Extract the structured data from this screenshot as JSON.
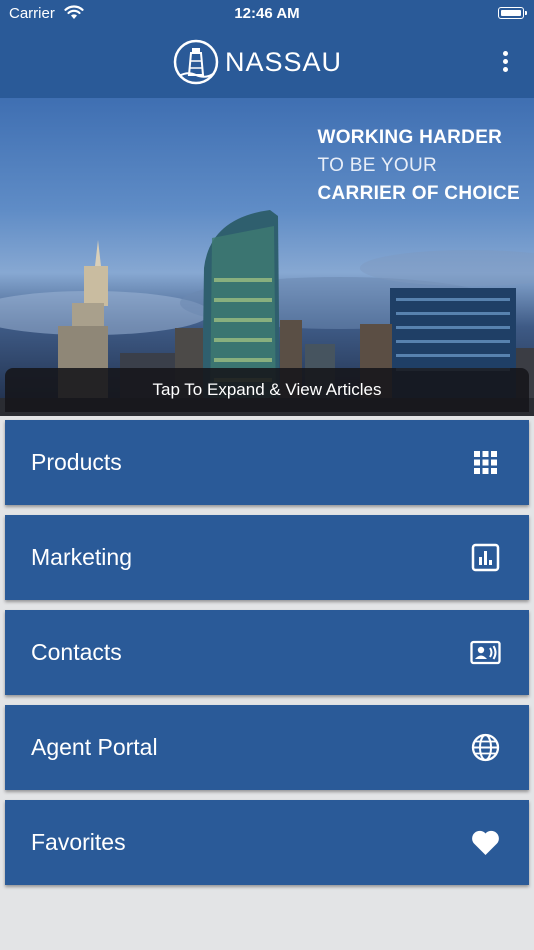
{
  "status_bar": {
    "carrier": "Carrier",
    "time": "12:46 AM"
  },
  "header": {
    "logo_text": "NASSAU"
  },
  "hero": {
    "tagline": [
      "WORKING HARDER",
      "TO BE YOUR",
      "CARRIER OF CHOICE"
    ],
    "expand_label": "Tap To Expand & View Articles"
  },
  "menu": {
    "items": [
      {
        "label": "Products",
        "icon": "grid-icon"
      },
      {
        "label": "Marketing",
        "icon": "bar-chart-icon"
      },
      {
        "label": "Contacts",
        "icon": "contact-card-icon"
      },
      {
        "label": "Agent Portal",
        "icon": "globe-icon"
      },
      {
        "label": "Favorites",
        "icon": "heart-icon"
      }
    ]
  },
  "colors": {
    "primary": "#2a5a98",
    "background": "#e3e4e6",
    "overlay": "#16161a"
  }
}
